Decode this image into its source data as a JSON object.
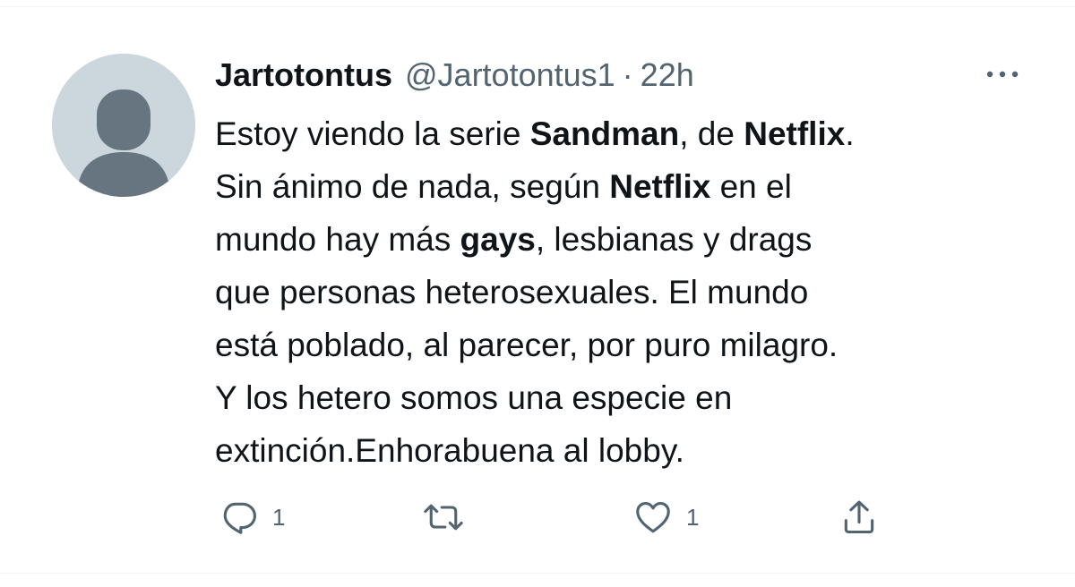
{
  "tweet": {
    "author": {
      "display_name": "Jartotontus",
      "handle": "@Jartotontus1"
    },
    "separator": "·",
    "time": "22h",
    "text_lines": [
      [
        {
          "text": "Estoy viendo la serie ",
          "bold": false
        },
        {
          "text": "Sandman",
          "bold": true
        },
        {
          "text": ", de ",
          "bold": false
        },
        {
          "text": "Netflix",
          "bold": true
        },
        {
          "text": ".",
          "bold": false
        }
      ],
      [
        {
          "text": "Sin ánimo de nada, según ",
          "bold": false
        },
        {
          "text": "Netflix",
          "bold": true
        },
        {
          "text": " en el",
          "bold": false
        }
      ],
      [
        {
          "text": "mundo hay más ",
          "bold": false
        },
        {
          "text": "gays",
          "bold": true
        },
        {
          "text": ", lesbianas y drags",
          "bold": false
        }
      ],
      [
        {
          "text": "que personas heterosexuales. El mundo",
          "bold": false
        }
      ],
      [
        {
          "text": "está poblado, al parecer, por puro milagro.",
          "bold": false
        }
      ],
      [
        {
          "text": "Y los hetero somos una especie en",
          "bold": false
        }
      ],
      [
        {
          "text": "extinción.Enhorabuena al lobby.",
          "bold": false
        }
      ]
    ],
    "actions": {
      "reply": {
        "icon": "reply-icon",
        "count": "1"
      },
      "retweet": {
        "icon": "retweet-icon",
        "count": ""
      },
      "like": {
        "icon": "heart-icon",
        "count": "1"
      },
      "share": {
        "icon": "share-icon"
      }
    }
  },
  "colors": {
    "text_primary": "#0f1419",
    "text_secondary": "#536471",
    "avatar_bg": "#ccd6dd",
    "avatar_figure": "#66757f",
    "border": "#eff3f4"
  }
}
